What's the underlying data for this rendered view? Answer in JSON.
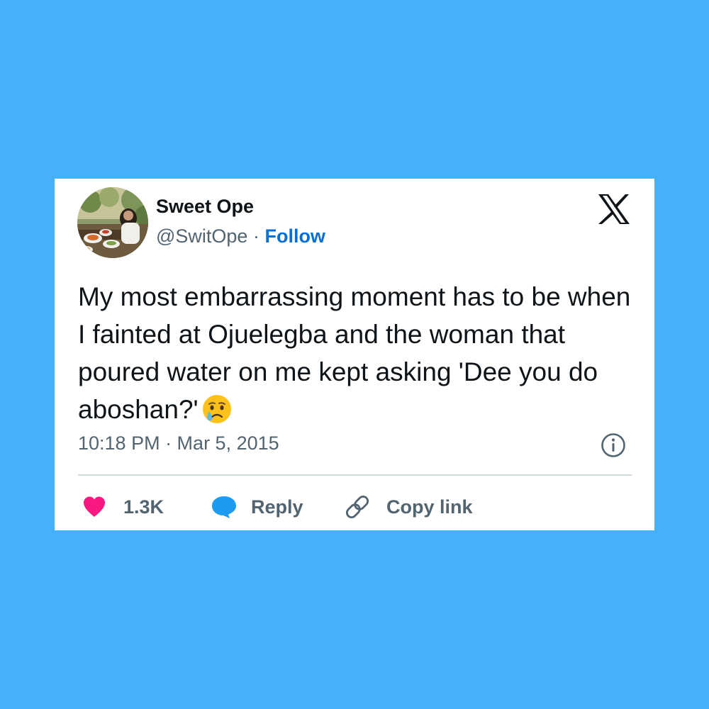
{
  "tweet": {
    "author": {
      "display_name": "Sweet Ope",
      "handle": "@SwitOpe",
      "separator": " · ",
      "follow_label": "Follow"
    },
    "brand_icon": "x-logo-icon",
    "text": "My most embarrassing moment has to be when I fainted at Ojuelegba and the woman that poured water on me kept asking 'Dee you do aboshan?'",
    "emoji": "crying-face-emoji",
    "timestamp": "10:18 PM · Mar 5, 2015",
    "info_icon": "info-icon"
  },
  "actions": {
    "like": {
      "icon": "heart-icon",
      "label": "1.3K"
    },
    "reply": {
      "icon": "speech-bubble-icon",
      "label": "Reply"
    },
    "copy_link": {
      "icon": "link-icon",
      "label": "Copy link"
    }
  },
  "colors": {
    "background": "#47b0fc",
    "card": "#ffffff",
    "text_primary": "#0f1419",
    "text_secondary": "#536471",
    "follow_link": "#0a6fd2",
    "like": "#f91880",
    "reply": "#1d9bf0",
    "divider": "#cfd9de"
  }
}
